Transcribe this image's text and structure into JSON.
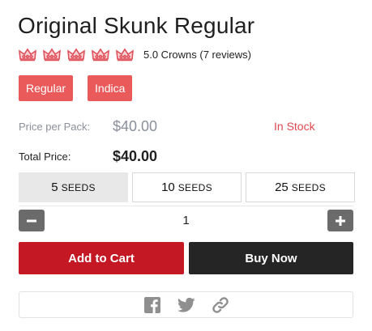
{
  "product": {
    "title": "Original Skunk Regular",
    "rating": 5.0,
    "rating_max": 5,
    "rating_text": "5.0 Crowns (7 reviews)",
    "rating_icon": "crown-icon",
    "tags": [
      "Regular",
      "Indica"
    ]
  },
  "pricing": {
    "price_per_pack_label": "Price per Pack:",
    "price_per_pack": "$40.00",
    "stock_status": "In Stock",
    "total_price_label": "Total Price:",
    "total_price": "$40.00"
  },
  "pack_options": [
    {
      "count": "5",
      "unit": "SEEDS",
      "selected": true
    },
    {
      "count": "10",
      "unit": "SEEDS",
      "selected": false
    },
    {
      "count": "25",
      "unit": "SEEDS",
      "selected": false
    }
  ],
  "quantity": {
    "value": "1",
    "minus_icon": "minus-icon",
    "plus_icon": "plus-icon"
  },
  "actions": {
    "add_to_cart": "Add to Cart",
    "buy_now": "Buy Now"
  },
  "share": {
    "icons": [
      "facebook-icon",
      "twitter-icon",
      "link-icon"
    ]
  },
  "colors": {
    "tag": "#ea5a5a",
    "crown": "#e0505a",
    "stock": "#e0494f",
    "add_to_cart": "#c41925",
    "buy_now": "#252525",
    "selected_pack": "#e8e8e8",
    "qty_button": "#6b6b6b",
    "share_icon": "#8f8f8f"
  }
}
